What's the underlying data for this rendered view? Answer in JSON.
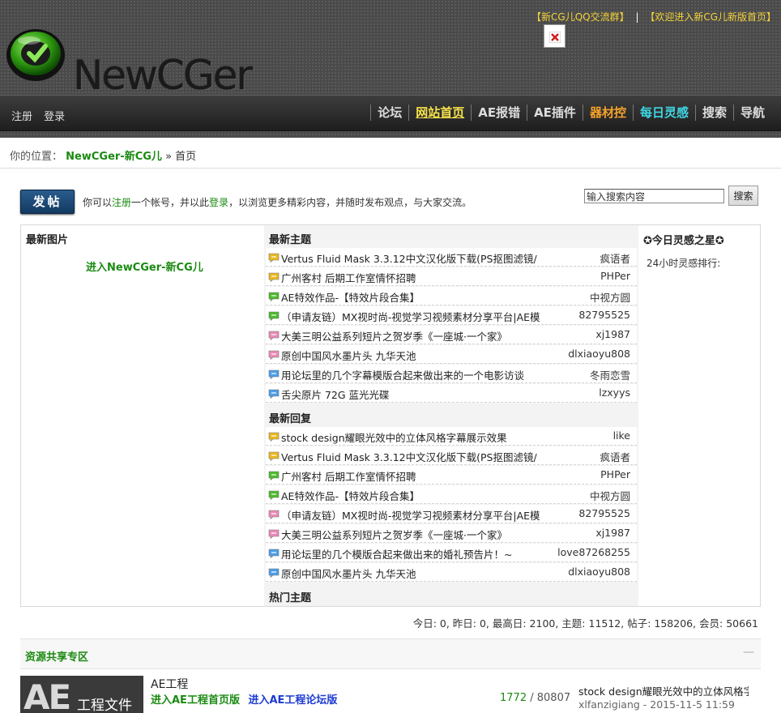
{
  "header": {
    "top_links": [
      "【新CG儿QQ交流群】",
      "【欢迎进入新CG儿新版首页】"
    ],
    "top_sep": "|",
    "logo_text_main": "NewCGer",
    "nav_left": [
      "注册",
      "登录"
    ],
    "nav_right": [
      "论坛",
      "网站首页",
      "AE报错",
      "AE插件",
      "器材控",
      "每日灵感",
      "搜索",
      "导航"
    ]
  },
  "breadcrumb": {
    "label": "你的位置：",
    "site": "NewCGer-新CG儿",
    "sep": "»",
    "current": "首页"
  },
  "post": {
    "button": "发帖",
    "notice_1": "你可以",
    "notice_register": "注册",
    "notice_2": "一个帐号，并以此",
    "notice_login": "登录",
    "notice_3": "，以浏览更多精彩内容，并随时发布观点，与大家交流。"
  },
  "search": {
    "value": "输入搜索内容",
    "button": "搜索"
  },
  "latest_pics": {
    "heading": "最新图片",
    "link": "进入NewCGer-新CG儿"
  },
  "latest_topics": {
    "heading": "最新主题",
    "rows": [
      {
        "title": "Vertus Fluid Mask 3.3.12中文汉化版下载(PS抠图滤镜/",
        "author": "疯语者",
        "icon": "yellow"
      },
      {
        "title": "广州客村 后期工作室情怀招聘",
        "author": "PHPer",
        "icon": "yellow"
      },
      {
        "title": "AE特效作品-【特效片段合集】",
        "author": "中视方圆",
        "icon": "green"
      },
      {
        "title": "（申请友链）MX视时尚-视觉学习视频素材分享平台|AE模",
        "author": "82795525",
        "icon": "green"
      },
      {
        "title": "大美三明公益系列短片之贺岁季《一座城·一个家》",
        "author": "xj1987",
        "icon": "pink"
      },
      {
        "title": "原创中国风水墨片头 九华天池",
        "author": "dlxiaoyu808",
        "icon": "pink"
      },
      {
        "title": "用论坛里的几个字幕模版合起来做出来的一个电影访谈",
        "author": "冬雨恋雪",
        "icon": "blue"
      },
      {
        "title": "舌尖原片 72G 蓝光光碟",
        "author": "lzxyys",
        "icon": "blue"
      }
    ]
  },
  "latest_replies": {
    "heading": "最新回复",
    "rows": [
      {
        "title": "stock design耀眼光效中的立体风格字幕展示效果",
        "author": "like",
        "icon": "yellow"
      },
      {
        "title": "Vertus Fluid Mask 3.3.12中文汉化版下载(PS抠图滤镜/",
        "author": "疯语者",
        "icon": "yellow"
      },
      {
        "title": "广州客村 后期工作室情怀招聘",
        "author": "PHPer",
        "icon": "green"
      },
      {
        "title": "AE特效作品-【特效片段合集】",
        "author": "中视方圆",
        "icon": "green"
      },
      {
        "title": "（申请友链）MX视时尚-视觉学习视频素材分享平台|AE模",
        "author": "82795525",
        "icon": "pink"
      },
      {
        "title": "大美三明公益系列短片之贺岁季《一座城·一个家》",
        "author": "xj1987",
        "icon": "pink"
      },
      {
        "title": "用论坛里的几个模版合起来做出来的婚礼预告片！~",
        "author": "love87268255",
        "icon": "blue"
      },
      {
        "title": "原创中国风水墨片头 九华天池",
        "author": "dlxiaoyu808",
        "icon": "blue"
      }
    ]
  },
  "hot_topics": {
    "heading": "热门主题"
  },
  "star": {
    "title": "✪今日灵感之星✪",
    "sub": "24小时灵感排行:"
  },
  "stats": "今日: 0, 昨日: 0, 最高日: 2100, 主题: 11512, 帖子: 158206, 会员: 50661",
  "resources": {
    "heading": "资源共享专区",
    "collapse": "—",
    "forum": {
      "thumb_big": "AE",
      "thumb_small": "工程文件",
      "title": "AE工程",
      "link_home": "进入AE工程首页版",
      "link_forum": "进入AE工程论坛版",
      "threads": "1772",
      "count_sep": " / ",
      "posts": "80807",
      "last_title": "stock design耀眼光效中的立体风格字幕展示效果",
      "last_meta": "xlfanzigiang - 2015-11-5 11:59"
    }
  },
  "colors": {
    "yellow": "#e8b820",
    "green": "#4cba2e",
    "pink": "#e88ab6",
    "blue": "#4d9ee6",
    "accent_green": "#1b8a12",
    "nav_home": "#f6e24a"
  }
}
